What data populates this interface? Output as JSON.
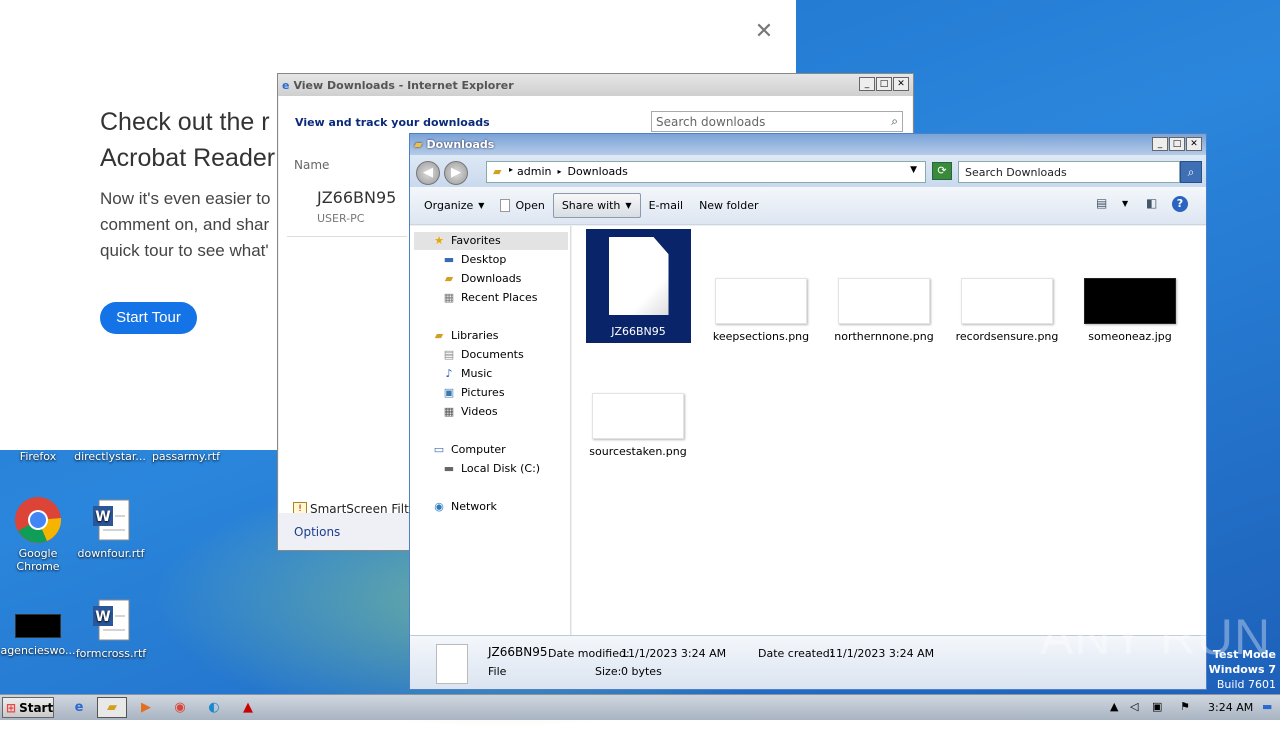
{
  "acrobat": {
    "heading_line1": "Check out the r",
    "heading_line2": "Acrobat Reader",
    "para_line1": "Now it's even easier to",
    "para_line2": "comment on, and shar",
    "para_line3": "quick tour to see what'",
    "start_tour": "Start Tour",
    "close_glyph": "✕"
  },
  "ie_window": {
    "title": "View Downloads - Internet Explorer",
    "heading": "View and track your downloads",
    "search_placeholder": "Search downloads",
    "column_name": "Name",
    "file_name": "JZ66BN95",
    "file_source": "USER-PC",
    "smartscreen": "SmartScreen Filte",
    "options": "Options"
  },
  "explorer": {
    "title": "Downloads",
    "breadcrumb": [
      "admin",
      "Downloads"
    ],
    "search_placeholder": "Search Downloads",
    "toolbar": {
      "organize": "Organize",
      "open": "Open",
      "share_with": "Share with",
      "email": "E-mail",
      "new_folder": "New folder"
    },
    "nav": {
      "favorites": "Favorites",
      "desktop": "Desktop",
      "downloads": "Downloads",
      "recent_places": "Recent Places",
      "libraries": "Libraries",
      "documents": "Documents",
      "music": "Music",
      "pictures": "Pictures",
      "videos": "Videos",
      "computer": "Computer",
      "local_disk": "Local Disk (C:)",
      "network": "Network"
    },
    "files": [
      {
        "name": "JZ66BN95"
      },
      {
        "name": "keepsections.png"
      },
      {
        "name": "northernnone.png"
      },
      {
        "name": "recordsensure.png"
      },
      {
        "name": "someoneaz.jpg"
      },
      {
        "name": "sourcestaken.png"
      }
    ],
    "details": {
      "name": "JZ66BN95",
      "type": "File",
      "modified_label": "Date modified:",
      "modified_value": "11/1/2023 3:24 AM",
      "created_label": "Date created:",
      "created_value": "11/1/2023 3:24 AM",
      "size_label": "Size:",
      "size_value": "0 bytes"
    }
  },
  "desktop_icons": {
    "firefox": "Firefox",
    "directlystar": "directlystar...",
    "passarmy": "passarmy.rtf",
    "chrome_line1": "Google",
    "chrome_line2": "Chrome",
    "downfour": "downfour.rtf",
    "agencies": "agencieswo...",
    "formcross": "formcross.rtf"
  },
  "watermark": "ANY RUN",
  "test_mode": {
    "line1": "Test Mode",
    "line2": "Windows 7",
    "line3": "Build 7601"
  },
  "taskbar": {
    "start": "Start",
    "clock": "3:24 AM"
  }
}
